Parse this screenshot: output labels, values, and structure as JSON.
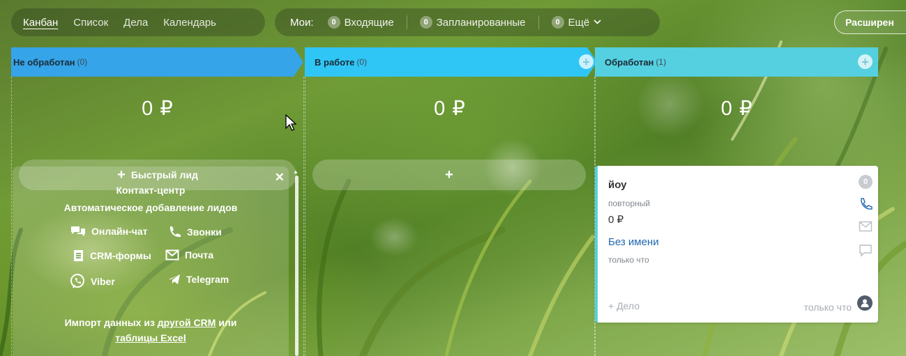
{
  "toolbar": {
    "views": [
      "Канбан",
      "Список",
      "Дела",
      "Календарь"
    ],
    "my_label": "Мои:",
    "counters": [
      {
        "count": "0",
        "label": "Входящие"
      },
      {
        "count": "0",
        "label": "Запланированные"
      },
      {
        "count": "0",
        "label": "Ещё"
      }
    ],
    "extended_label": "Расширен"
  },
  "columns": [
    {
      "name": "Не обработан",
      "count": "(0)",
      "sum": "0 ₽",
      "quick_label": "Быстрый лид",
      "color": "#35a4e8"
    },
    {
      "name": "В работе",
      "count": "(0)",
      "sum": "0 ₽",
      "quick_label": "",
      "color": "#2fc6f6"
    },
    {
      "name": "Обработан",
      "count": "(1)",
      "sum": "0 ₽",
      "quick_label": "",
      "color": "#55d0e0"
    }
  ],
  "promo": {
    "title": "Контакт-центр",
    "subtitle": "Автоматическое добавление лидов",
    "channels": {
      "chat": "Онлайн-чат",
      "calls": "Звонки",
      "forms": "CRM-формы",
      "mail": "Почта",
      "viber": "Viber",
      "telegram": "Telegram"
    },
    "import_prefix": "Импорт данных из",
    "import_link1": "другой CRM",
    "import_mid": "или",
    "import_link2": "таблицы Excel"
  },
  "card": {
    "title": "йоу",
    "stage": "повторный",
    "amount": "0 ₽",
    "client": "Без имени",
    "created": "только что",
    "add_activity": "+ Дело",
    "last_activity": "только что",
    "badge": "0"
  },
  "quick_plus": "+"
}
